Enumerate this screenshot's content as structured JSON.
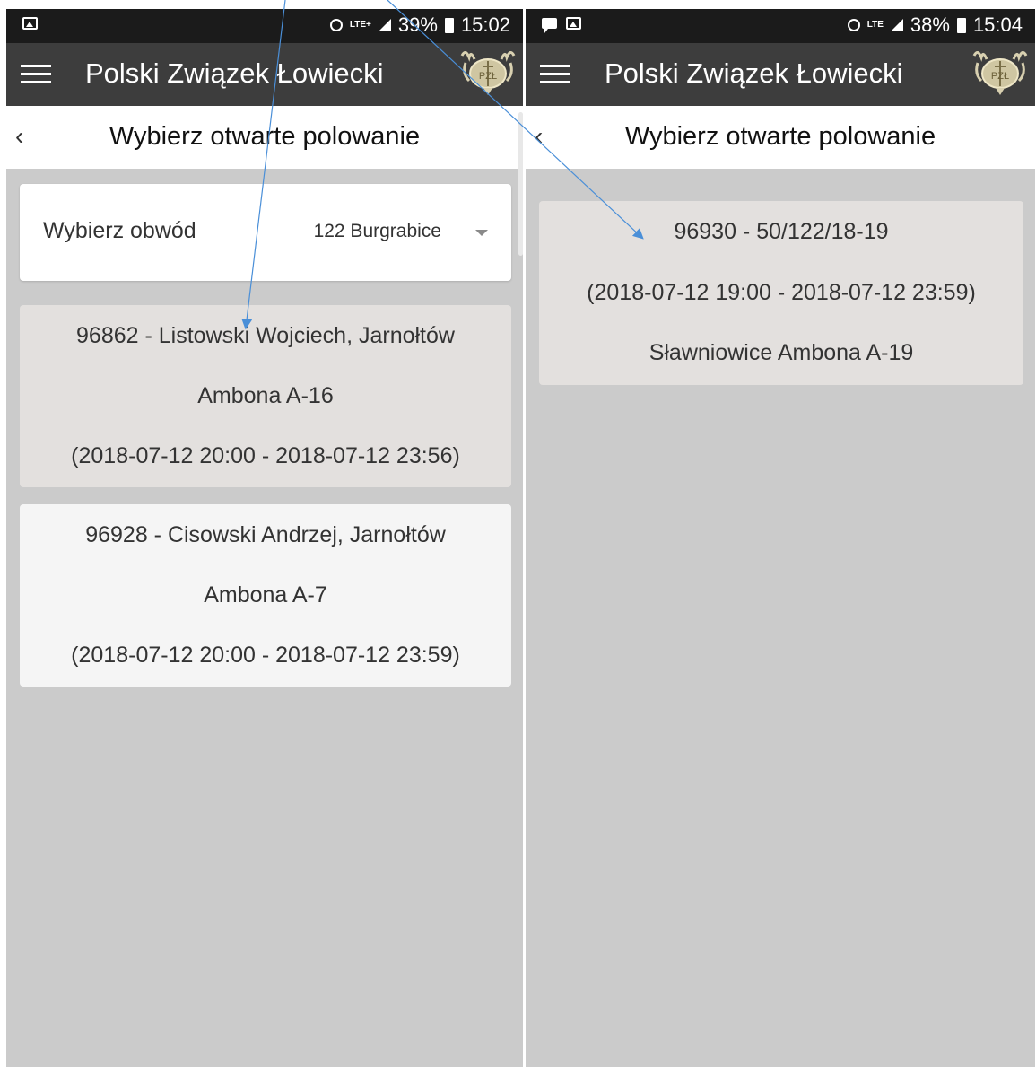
{
  "left_screen": {
    "status": {
      "network": "LTE+",
      "battery": "39%",
      "time": "15:02"
    },
    "app_title": "Polski Związek Łowiecki",
    "page_title": "Wybierz otwarte polowanie",
    "district_select": {
      "label": "Wybierz obwód",
      "value": "122 Burgrabice"
    },
    "hunts": [
      {
        "line1": "96862 - Listowski Wojciech, Jarnołtów",
        "line2": "Ambona A-16",
        "line3": "(2018-07-12 20:00 - 2018-07-12 23:56)"
      },
      {
        "line1": "96928 - Cisowski Andrzej, Jarnołtów",
        "line2": "Ambona A-7",
        "line3": "(2018-07-12 20:00 - 2018-07-12 23:59)"
      }
    ]
  },
  "right_screen": {
    "status": {
      "network": "LTE",
      "battery": "38%",
      "time": "15:04"
    },
    "app_title": "Polski Związek Łowiecki",
    "page_title": "Wybierz otwarte polowanie",
    "hunts": [
      {
        "line1": "96930 - 50/122/18-19",
        "line2": "(2018-07-12 19:00 - 2018-07-12 23:59)",
        "line3": "Sławniowice Ambona A-19"
      }
    ]
  },
  "logo_text": "PZŁ",
  "colors": {
    "statusbar": "#1b1b1b",
    "appbar": "#3d3d3d",
    "background": "#cbcbcb",
    "card_selected": "#e3e0de",
    "card": "#f5f5f5",
    "annotation_arrow": "#4a8fd8"
  }
}
